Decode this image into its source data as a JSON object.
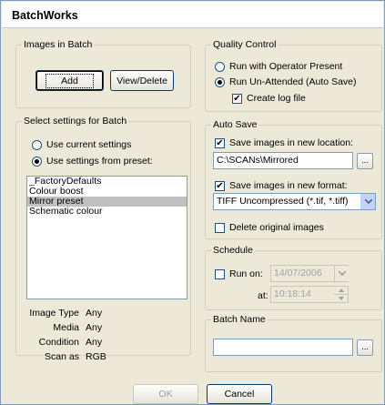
{
  "window": {
    "title": "BatchWorks"
  },
  "images_in_batch": {
    "legend": "Images in Batch",
    "add_label": "Add",
    "view_delete_label": "View/Delete"
  },
  "quality_control": {
    "legend": "Quality Control",
    "operator_label": "Run with Operator Present",
    "unattended_label": "Run Un-Attended (Auto Save)",
    "selected": "unattended",
    "create_log_label": "Create log file",
    "create_log_checked": true
  },
  "settings": {
    "legend": "Select settings for Batch",
    "use_current_label": "Use current settings",
    "use_preset_label": "Use settings from preset:",
    "selected": "preset",
    "presets": [
      "_FactoryDefaults",
      "Colour boost",
      "Mirror preset",
      "Schematic colour"
    ],
    "selected_preset": "Mirror preset",
    "info": [
      {
        "key": "Image Type",
        "value": "Any"
      },
      {
        "key": "Media",
        "value": "Any"
      },
      {
        "key": "Condition",
        "value": "Any"
      },
      {
        "key": "Scan as",
        "value": "RGB"
      }
    ]
  },
  "auto_save": {
    "legend": "Auto Save",
    "save_location_label": "Save images in new location:",
    "save_location_checked": true,
    "location_value": "C:\\SCANs\\Mirrored",
    "browse_label": "...",
    "save_format_label": "Save images in new format:",
    "save_format_checked": true,
    "format_value": "TIFF Uncompressed (*.tif, *.tiff)",
    "delete_label": "Delete original images",
    "delete_checked": false
  },
  "schedule": {
    "legend": "Schedule",
    "run_on_label": "Run on:",
    "run_on_checked": false,
    "date_value": "14/07/2006",
    "at_label": "at:",
    "time_value": "10:18:14"
  },
  "batch_name": {
    "legend": "Batch Name",
    "value": "",
    "browse_label": "..."
  },
  "footer": {
    "ok_label": "OK",
    "cancel_label": "Cancel"
  },
  "icons": {
    "check": "checkmark-icon",
    "dropdown": "chevron-down-icon",
    "spin_up": "spin-up-icon",
    "spin_down": "spin-down-icon"
  }
}
